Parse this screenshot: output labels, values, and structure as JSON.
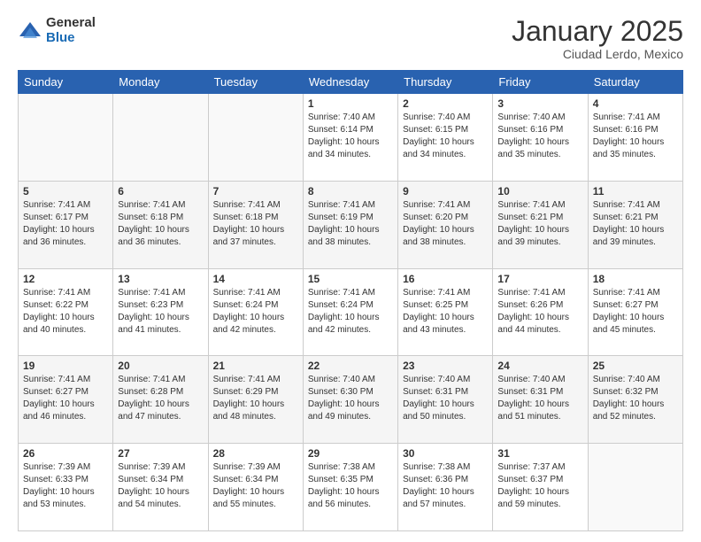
{
  "logo": {
    "general": "General",
    "blue": "Blue"
  },
  "title": {
    "month": "January 2025",
    "location": "Ciudad Lerdo, Mexico"
  },
  "weekdays": [
    "Sunday",
    "Monday",
    "Tuesday",
    "Wednesday",
    "Thursday",
    "Friday",
    "Saturday"
  ],
  "weeks": [
    [
      {
        "day": "",
        "info": ""
      },
      {
        "day": "",
        "info": ""
      },
      {
        "day": "",
        "info": ""
      },
      {
        "day": "1",
        "info": "Sunrise: 7:40 AM\nSunset: 6:14 PM\nDaylight: 10 hours\nand 34 minutes."
      },
      {
        "day": "2",
        "info": "Sunrise: 7:40 AM\nSunset: 6:15 PM\nDaylight: 10 hours\nand 34 minutes."
      },
      {
        "day": "3",
        "info": "Sunrise: 7:40 AM\nSunset: 6:16 PM\nDaylight: 10 hours\nand 35 minutes."
      },
      {
        "day": "4",
        "info": "Sunrise: 7:41 AM\nSunset: 6:16 PM\nDaylight: 10 hours\nand 35 minutes."
      }
    ],
    [
      {
        "day": "5",
        "info": "Sunrise: 7:41 AM\nSunset: 6:17 PM\nDaylight: 10 hours\nand 36 minutes."
      },
      {
        "day": "6",
        "info": "Sunrise: 7:41 AM\nSunset: 6:18 PM\nDaylight: 10 hours\nand 36 minutes."
      },
      {
        "day": "7",
        "info": "Sunrise: 7:41 AM\nSunset: 6:18 PM\nDaylight: 10 hours\nand 37 minutes."
      },
      {
        "day": "8",
        "info": "Sunrise: 7:41 AM\nSunset: 6:19 PM\nDaylight: 10 hours\nand 38 minutes."
      },
      {
        "day": "9",
        "info": "Sunrise: 7:41 AM\nSunset: 6:20 PM\nDaylight: 10 hours\nand 38 minutes."
      },
      {
        "day": "10",
        "info": "Sunrise: 7:41 AM\nSunset: 6:21 PM\nDaylight: 10 hours\nand 39 minutes."
      },
      {
        "day": "11",
        "info": "Sunrise: 7:41 AM\nSunset: 6:21 PM\nDaylight: 10 hours\nand 39 minutes."
      }
    ],
    [
      {
        "day": "12",
        "info": "Sunrise: 7:41 AM\nSunset: 6:22 PM\nDaylight: 10 hours\nand 40 minutes."
      },
      {
        "day": "13",
        "info": "Sunrise: 7:41 AM\nSunset: 6:23 PM\nDaylight: 10 hours\nand 41 minutes."
      },
      {
        "day": "14",
        "info": "Sunrise: 7:41 AM\nSunset: 6:24 PM\nDaylight: 10 hours\nand 42 minutes."
      },
      {
        "day": "15",
        "info": "Sunrise: 7:41 AM\nSunset: 6:24 PM\nDaylight: 10 hours\nand 42 minutes."
      },
      {
        "day": "16",
        "info": "Sunrise: 7:41 AM\nSunset: 6:25 PM\nDaylight: 10 hours\nand 43 minutes."
      },
      {
        "day": "17",
        "info": "Sunrise: 7:41 AM\nSunset: 6:26 PM\nDaylight: 10 hours\nand 44 minutes."
      },
      {
        "day": "18",
        "info": "Sunrise: 7:41 AM\nSunset: 6:27 PM\nDaylight: 10 hours\nand 45 minutes."
      }
    ],
    [
      {
        "day": "19",
        "info": "Sunrise: 7:41 AM\nSunset: 6:27 PM\nDaylight: 10 hours\nand 46 minutes."
      },
      {
        "day": "20",
        "info": "Sunrise: 7:41 AM\nSunset: 6:28 PM\nDaylight: 10 hours\nand 47 minutes."
      },
      {
        "day": "21",
        "info": "Sunrise: 7:41 AM\nSunset: 6:29 PM\nDaylight: 10 hours\nand 48 minutes."
      },
      {
        "day": "22",
        "info": "Sunrise: 7:40 AM\nSunset: 6:30 PM\nDaylight: 10 hours\nand 49 minutes."
      },
      {
        "day": "23",
        "info": "Sunrise: 7:40 AM\nSunset: 6:31 PM\nDaylight: 10 hours\nand 50 minutes."
      },
      {
        "day": "24",
        "info": "Sunrise: 7:40 AM\nSunset: 6:31 PM\nDaylight: 10 hours\nand 51 minutes."
      },
      {
        "day": "25",
        "info": "Sunrise: 7:40 AM\nSunset: 6:32 PM\nDaylight: 10 hours\nand 52 minutes."
      }
    ],
    [
      {
        "day": "26",
        "info": "Sunrise: 7:39 AM\nSunset: 6:33 PM\nDaylight: 10 hours\nand 53 minutes."
      },
      {
        "day": "27",
        "info": "Sunrise: 7:39 AM\nSunset: 6:34 PM\nDaylight: 10 hours\nand 54 minutes."
      },
      {
        "day": "28",
        "info": "Sunrise: 7:39 AM\nSunset: 6:34 PM\nDaylight: 10 hours\nand 55 minutes."
      },
      {
        "day": "29",
        "info": "Sunrise: 7:38 AM\nSunset: 6:35 PM\nDaylight: 10 hours\nand 56 minutes."
      },
      {
        "day": "30",
        "info": "Sunrise: 7:38 AM\nSunset: 6:36 PM\nDaylight: 10 hours\nand 57 minutes."
      },
      {
        "day": "31",
        "info": "Sunrise: 7:37 AM\nSunset: 6:37 PM\nDaylight: 10 hours\nand 59 minutes."
      },
      {
        "day": "",
        "info": ""
      }
    ]
  ]
}
